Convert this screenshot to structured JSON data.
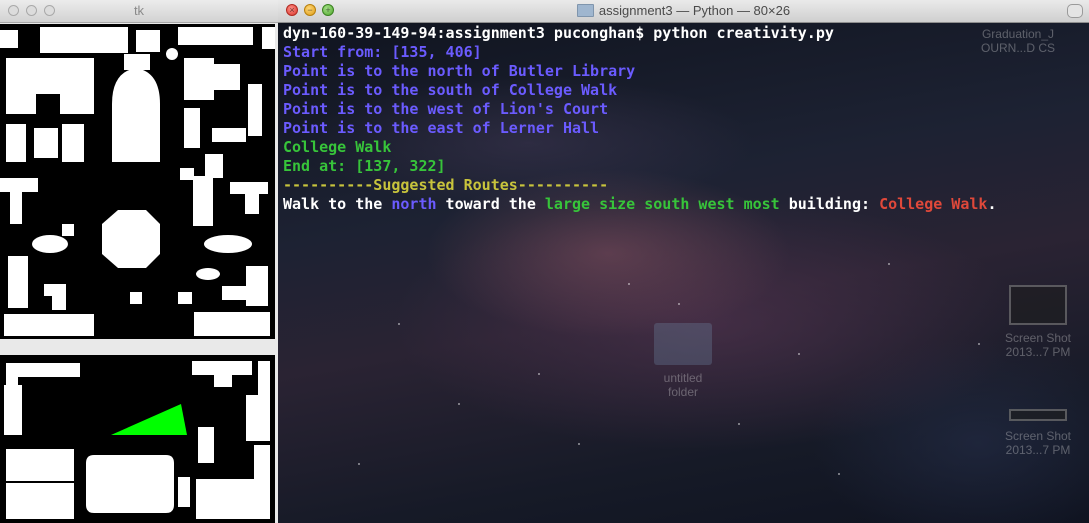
{
  "tk_window": {
    "title": "tk"
  },
  "terminal": {
    "title": "assignment3 — Python — 80×26",
    "lines": [
      [
        {
          "t": "dyn-160-39-149-94:assignment3 puconghan$ python creativity.py",
          "c": "white"
        }
      ],
      [
        {
          "t": "Start from: [135, 406]",
          "c": "blue"
        }
      ],
      [
        {
          "t": "Point is to the north of Butler Library",
          "c": "blue"
        }
      ],
      [
        {
          "t": "Point is to the south of College Walk",
          "c": "blue"
        }
      ],
      [
        {
          "t": "Point is to the west of Lion's Court",
          "c": "blue"
        }
      ],
      [
        {
          "t": "Point is to the east of Lerner Hall",
          "c": "blue"
        }
      ],
      [
        {
          "t": "College Walk",
          "c": "green"
        }
      ],
      [
        {
          "t": "End at: [137, 322]",
          "c": "green"
        }
      ],
      [
        {
          "t": "----------Suggested Routes----------",
          "c": "yellow"
        }
      ],
      [
        {
          "t": "Walk to the ",
          "c": "white"
        },
        {
          "t": "north",
          "c": "blue"
        },
        {
          "t": " toward the ",
          "c": "white"
        },
        {
          "t": "large size south west most",
          "c": "green"
        },
        {
          "t": " building: ",
          "c": "white"
        },
        {
          "t": "College Walk",
          "c": "red"
        },
        {
          "t": ".",
          "c": "white"
        }
      ]
    ]
  },
  "desktop": {
    "top_right_label": [
      "Graduation_J",
      "OURN...D CS"
    ],
    "folder_label": [
      "untitled",
      "folder"
    ],
    "screenshot1_label": [
      "Screen Shot",
      "2013...7 PM"
    ],
    "screenshot2_label": [
      "Screen Shot",
      "2013...7 PM"
    ]
  },
  "colors": {
    "blue": "#6b5bff",
    "green": "#37c43a",
    "yellow": "#c8c43c",
    "red": "#e0483a",
    "white": "#ffffff",
    "route_shape": "#00ff00"
  }
}
